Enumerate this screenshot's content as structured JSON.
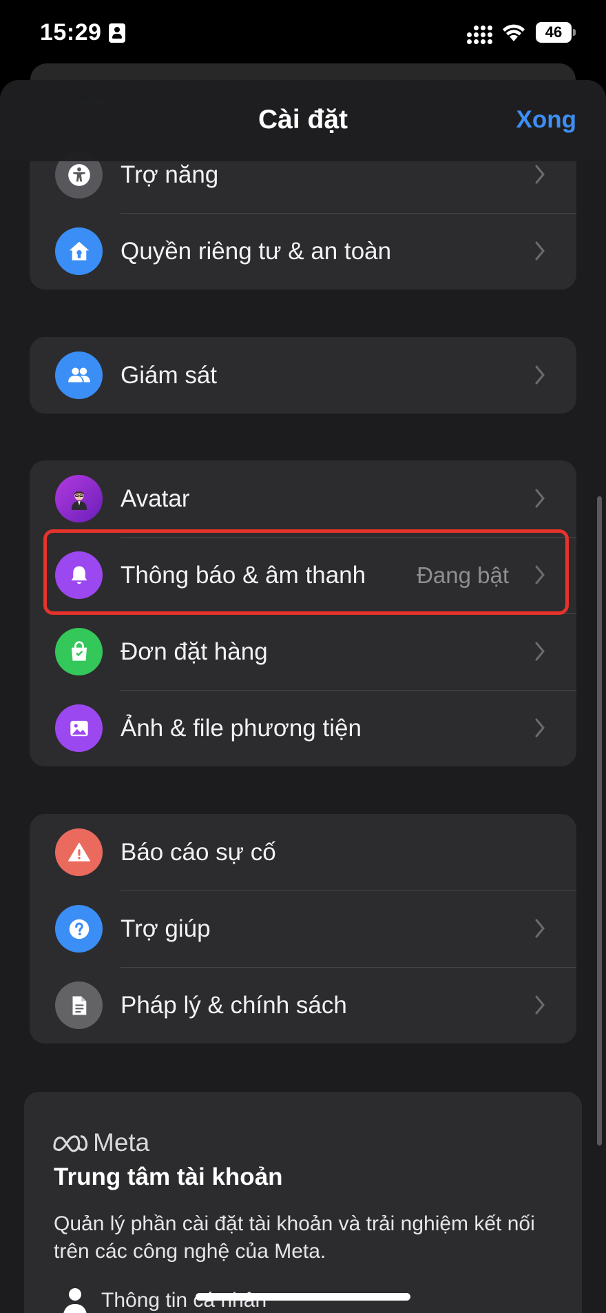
{
  "status_bar": {
    "time": "15:29",
    "battery": "46"
  },
  "nav": {
    "title": "Cài đặt",
    "done_label": "Xong"
  },
  "groups": [
    {
      "rows": [
        {
          "label": "Trợ năng",
          "icon": "accessibility-icon",
          "color": "#58585c"
        },
        {
          "label": "Quyền riêng tư & an toàn",
          "icon": "privacy-home-icon",
          "color": "#3a8ef6"
        }
      ]
    },
    {
      "rows": [
        {
          "label": "Giám sát",
          "icon": "people-icon",
          "color": "#3a8ef6"
        }
      ]
    },
    {
      "rows": [
        {
          "label": "Avatar",
          "icon": "avatar-icon",
          "color": "#8f2bd4"
        },
        {
          "label": "Thông báo & âm thanh",
          "value": "Đang bật",
          "icon": "bell-icon",
          "color": "#9c48f1"
        },
        {
          "label": "Đơn đặt hàng",
          "icon": "shopping-bag-icon",
          "color": "#34c759"
        },
        {
          "label": "Ảnh & file phương tiện",
          "icon": "photo-icon",
          "color": "#9c48f1"
        }
      ]
    },
    {
      "rows": [
        {
          "label": "Báo cáo sự cố",
          "icon": "warning-icon",
          "color": "#eb6a5e"
        },
        {
          "label": "Trợ giúp",
          "icon": "help-icon",
          "color": "#3a8ef6"
        },
        {
          "label": "Pháp lý & chính sách",
          "icon": "document-icon",
          "color": "#636366"
        }
      ]
    }
  ],
  "meta": {
    "logo_text": "Meta",
    "title": "Trung tâm tài khoản",
    "description": "Quản lý phần cài đặt tài khoản và trải nghiệm kết nối trên các công nghệ của Meta.",
    "item": "Thông tin cá nhân"
  },
  "colors": {
    "accent": "#3d8ff5",
    "highlight": "#e6332b"
  }
}
